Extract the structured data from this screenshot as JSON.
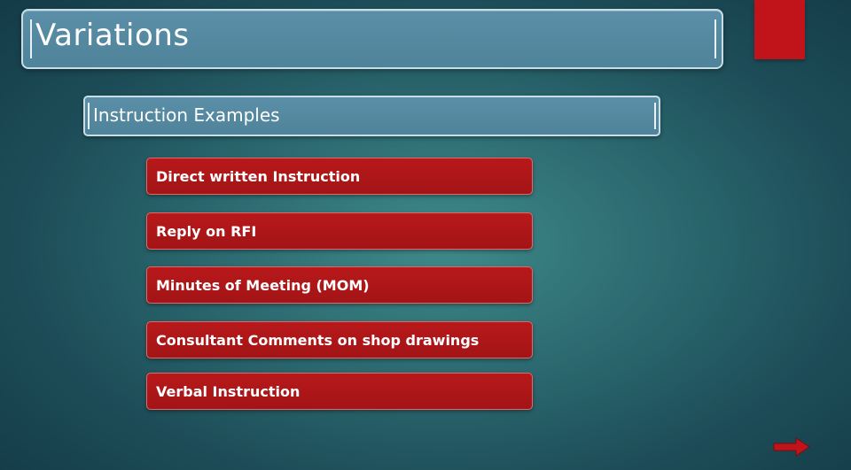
{
  "slide": {
    "title": "Variations",
    "subtitle": "Instruction Examples",
    "items": [
      {
        "label": "Direct written Instruction"
      },
      {
        "label": "Reply on RFI"
      },
      {
        "label": "Minutes of Meeting (MOM)"
      },
      {
        "label": "Consultant Comments on shop drawings"
      },
      {
        "label": "Verbal Instruction"
      }
    ]
  },
  "colors": {
    "accent_red": "#c0141a",
    "bar_blue": "#5a8fa7",
    "background_teal": "#2d6c72"
  },
  "icons": {
    "next": "right-arrow-icon"
  }
}
